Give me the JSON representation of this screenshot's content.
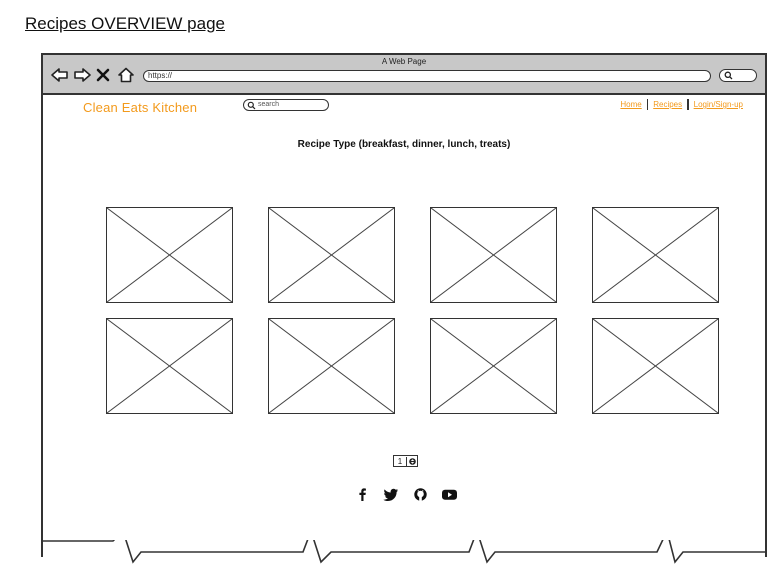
{
  "page_heading": "Recipes OVERVIEW page",
  "browser": {
    "window_title": "A Web Page",
    "url": "https://"
  },
  "site": {
    "logo": "Clean Eats Kitchen",
    "search_placeholder": "search",
    "nav": [
      {
        "label": "Home"
      },
      {
        "label": "Recipes"
      },
      {
        "label": "Login/Sign-up"
      }
    ]
  },
  "main": {
    "section_title": "Recipe Type (breakfast, dinner, lunch, treats)",
    "recipe_cards": 8
  },
  "pagination": {
    "current_page": "1"
  },
  "social": [
    {
      "icon": "facebook-icon"
    },
    {
      "icon": "twitter-icon"
    },
    {
      "icon": "github-icon"
    },
    {
      "icon": "youtube-icon"
    }
  ],
  "colors": {
    "accent": "#f39a1c",
    "chrome": "#c8c8c8"
  }
}
